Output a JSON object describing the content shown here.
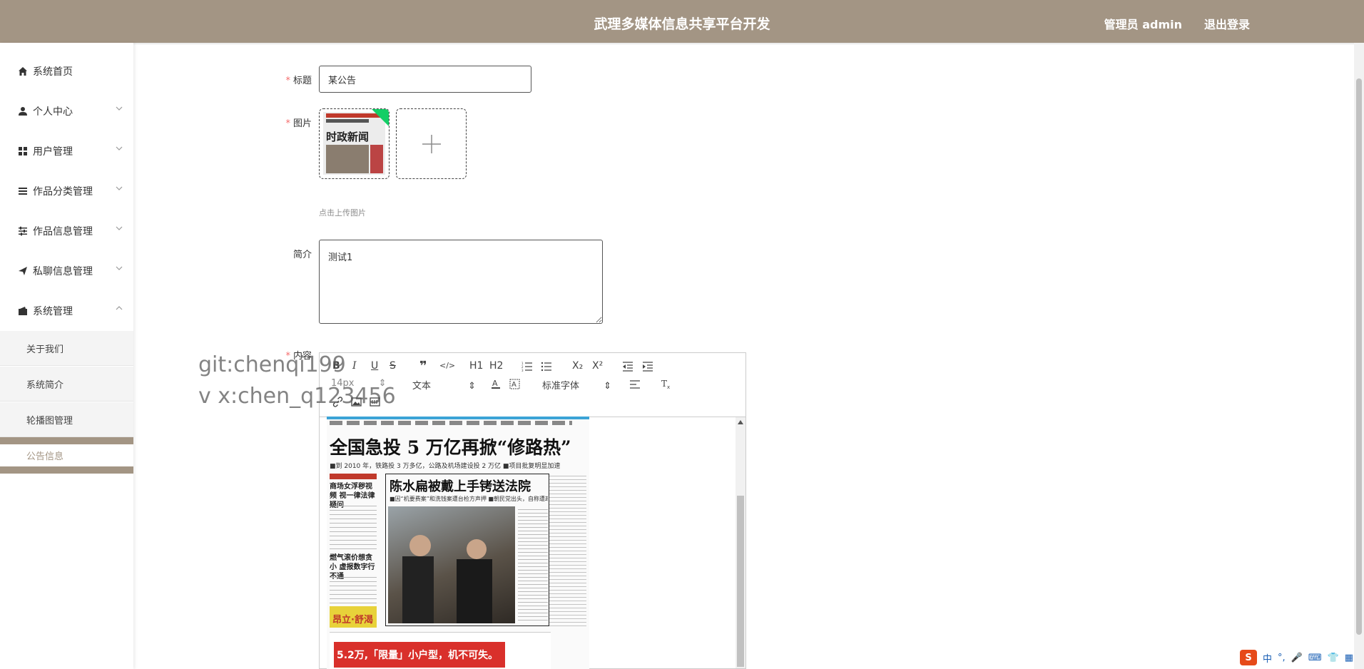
{
  "header": {
    "title": "武理多媒体信息共享平台开发",
    "user": "管理员 admin",
    "logout": "退出登录"
  },
  "sidebar": {
    "items": [
      {
        "label": "系统首页",
        "icon": "home-icon"
      },
      {
        "label": "个人中心",
        "icon": "user-icon"
      },
      {
        "label": "用户管理",
        "icon": "grid-icon"
      },
      {
        "label": "作品分类管理",
        "icon": "list-icon"
      },
      {
        "label": "作品信息管理",
        "icon": "sliders-icon"
      },
      {
        "label": "私聊信息管理",
        "icon": "send-icon"
      },
      {
        "label": "系统管理",
        "icon": "wallet-icon"
      }
    ],
    "sub_items": [
      "关于我们",
      "系统简介",
      "轮播图管理",
      "公告信息"
    ]
  },
  "form": {
    "title_label": "标题",
    "title_value": "某公告",
    "image_label": "图片",
    "upload_tip": "点击上传图片",
    "intro_label": "简介",
    "intro_value": "测试1",
    "content_label": "内容"
  },
  "editor": {
    "toolbar_row1": [
      "B",
      "I",
      "U",
      "S",
      "❞",
      "</>",
      "H1",
      "H2",
      "ordered-list-icon",
      "bullet-list-icon",
      "X₂",
      "X²",
      "outdent-icon",
      "indent-icon"
    ],
    "font_size": "14px",
    "text_style": "文本",
    "font_family": "标准字体"
  },
  "newspaper": {
    "headline": "全国急投 5 万亿再掀“修路热”",
    "subline": "■到 2010 年，铁路投 3 万多亿，公路及机场建设投 2 万亿  ■项目批复明显加速",
    "main_story": "陈水扁被戴上手铐送法院",
    "main_sub": "■因“机要费案”和洗钱案遭台检方声押  ■朝民党出头，自称遭政治迫害",
    "left_story1": "商场女浮秽视频 视一律法律疑问",
    "left_story2": "燃气滚价想贪小 虚报数字行不通",
    "ad_text": "昂立·舒渴",
    "thumb_text": "时政新闻",
    "bottom_ad": "5.2万,「限量」小户型，机不可失。"
  },
  "watermark": {
    "line1": "git:chenqi199",
    "line2": "v x:chen_q123456"
  },
  "ime": {
    "label": "中"
  }
}
